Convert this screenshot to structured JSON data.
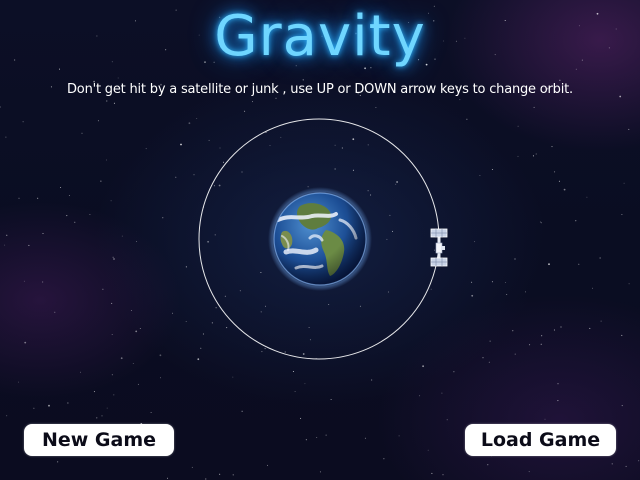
{
  "game": {
    "title": "Gravity",
    "instructions": "Don't get hit by a satellite or junk , use UP or DOWN arrow keys to change orbit."
  },
  "scene": {
    "planet_icon": "earth-icon",
    "satellite_icon": "satellite-icon"
  },
  "menu": {
    "new_game_label": "New Game",
    "load_game_label": "Load Game"
  },
  "colors": {
    "title_glow": "#6fd6ff",
    "button_bg": "#ffffff",
    "button_text": "#0b0b18",
    "background": "#0a0e22",
    "orbit_line": "#ffffff"
  }
}
